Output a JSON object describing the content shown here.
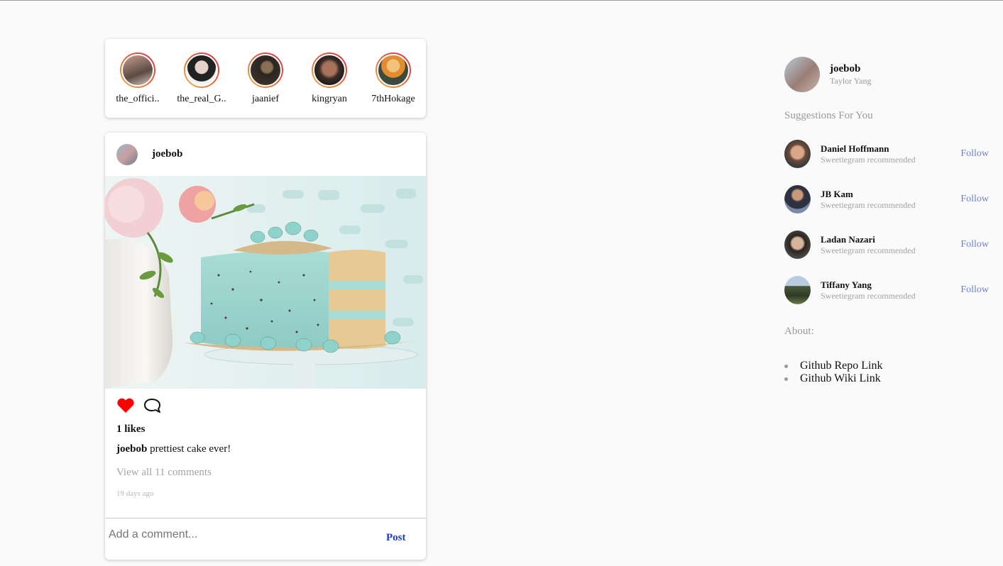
{
  "stories": [
    {
      "username": "the_offici.."
    },
    {
      "username": "the_real_G.."
    },
    {
      "username": "jaanief"
    },
    {
      "username": "kingryan"
    },
    {
      "username": "7thHokage"
    }
  ],
  "post": {
    "username": "joebob",
    "likes": "1 likes",
    "caption_user": "joebob",
    "caption_text": "prettiest cake ever!",
    "view_comments": "View all 11 comments",
    "timestamp": "19 days ago",
    "comment_placeholder": "Add a comment...",
    "post_label": "Post",
    "liked": true
  },
  "profile": {
    "username": "joebob",
    "name": "Taylor Yang"
  },
  "suggestions": {
    "title": "Suggestions For You",
    "items": [
      {
        "name": "Daniel Hoffmann",
        "subtitle": "Sweetiegram recommended",
        "follow": "Follow"
      },
      {
        "name": "JB Kam",
        "subtitle": "Sweetiegram recommended",
        "follow": "Follow"
      },
      {
        "name": "Ladan Nazari",
        "subtitle": "Sweetiegram recommended",
        "follow": "Follow"
      },
      {
        "name": "Tiffany Yang",
        "subtitle": "Sweetiegram recommended",
        "follow": "Follow"
      }
    ]
  },
  "about": {
    "title": "About:",
    "links": [
      "Github Repo Link",
      "Github Wiki Link"
    ]
  },
  "colors": {
    "like": "#ff0000",
    "post_button": "#1a3cc9",
    "follow": "#6b7fd9"
  }
}
